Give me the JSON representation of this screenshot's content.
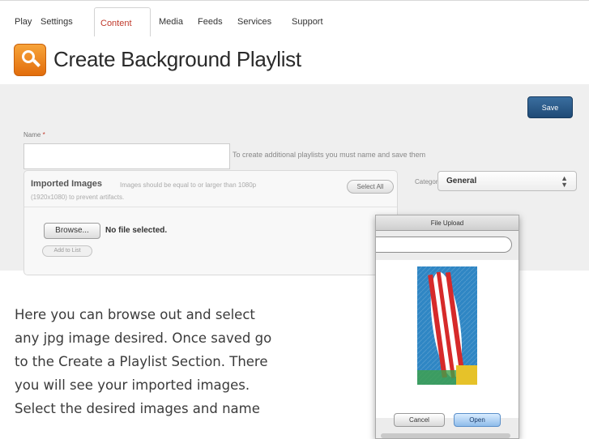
{
  "nav": {
    "tabs": [
      "Play",
      "Settings",
      "Content",
      "Media",
      "Feeds",
      "Services",
      "Support"
    ],
    "active": "Content"
  },
  "header": {
    "title": "Create Background Playlist",
    "icon": "magnifier-icon"
  },
  "toolbar": {
    "save_label": "Save"
  },
  "form": {
    "name_label": "Name",
    "required_mark": "*",
    "name_value": "",
    "name_hint": "To create additional playlists you must name and save them",
    "category_label": "Category",
    "category_value": "General"
  },
  "imported": {
    "title": "Imported Images",
    "note_line1": "Images should be equal to or larger than 1080p",
    "note_line2": "(1920x1080) to prevent artifacts.",
    "select_all_label": "Select All",
    "browse_label": "Browse...",
    "file_status": "No file selected.",
    "add_label": "Add to List"
  },
  "dialog": {
    "title": "File Upload",
    "cancel_label": "Cancel",
    "open_label": "Open"
  },
  "paragraph": {
    "lines": [
      "Here you can browse out and select",
      "any jpg image desired. Once saved go",
      "to the Create a Playlist Section. There",
      "you will see your imported images.",
      "Select the desired images and name"
    ]
  }
}
